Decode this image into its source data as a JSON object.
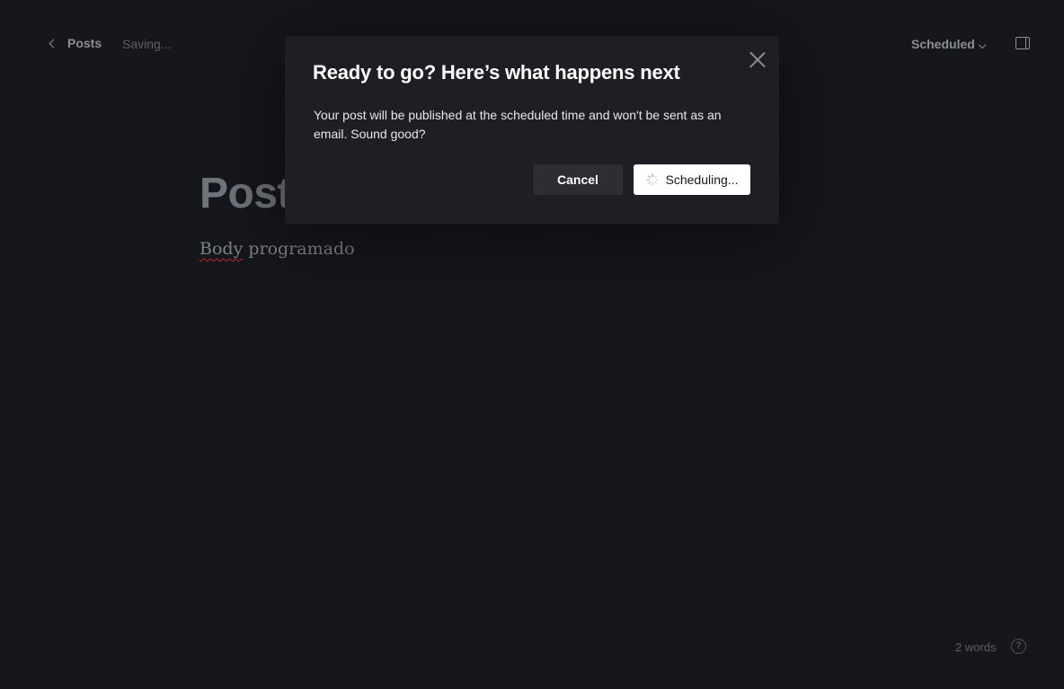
{
  "header": {
    "back_label": "Posts",
    "save_status": "Saving...",
    "status_label": "Scheduled"
  },
  "editor": {
    "title": "Post",
    "body_word1": "Body",
    "body_word2": " programado"
  },
  "footer": {
    "word_count": "2 words",
    "help_glyph": "?"
  },
  "modal": {
    "title": "Ready to go? Here’s what happens next",
    "body": "Your post will be published at the scheduled time and won't be sent as an email. Sound good?",
    "cancel_label": "Cancel",
    "confirm_label": "Scheduling..."
  },
  "icons": {
    "back": "chevron-left-icon",
    "status": "chevron-down-icon",
    "sidebar": "sidebar-toggle-icon",
    "close": "close-icon",
    "spinner": "spinner-icon",
    "help": "help-icon"
  },
  "colors": {
    "background": "#16171c",
    "modal_background": "#1d1f24",
    "primary_button": "#ffffff",
    "secondary_button": "#2c2e33"
  }
}
